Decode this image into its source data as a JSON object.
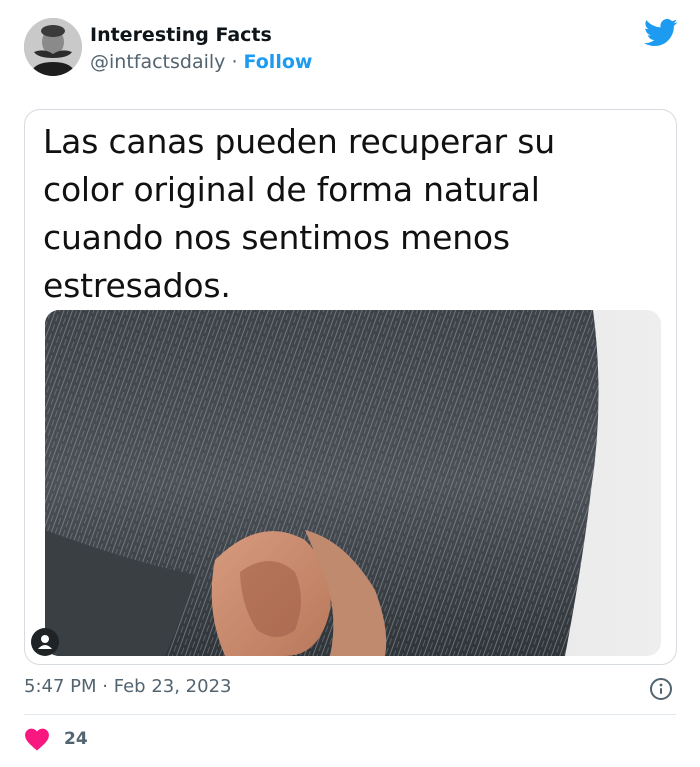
{
  "author": {
    "display_name": "Interesting Facts",
    "handle": "@intfactsdaily",
    "separator": "·",
    "follow_label": "Follow"
  },
  "tweet": {
    "text": "Las canas pueden recuperar su color original de forma natural cuando nos sentimos menos estresados.",
    "time": "5:47 PM",
    "date_separator": "·",
    "date": "Feb 23, 2023",
    "likes": "24"
  },
  "icons": {
    "logo": "twitter-bird-icon",
    "info": "info-icon",
    "like": "heart-icon",
    "photo_credit": "person-icon"
  },
  "colors": {
    "accent": "#1d9bf0",
    "like": "#f91880",
    "secondary_text": "#536471"
  }
}
